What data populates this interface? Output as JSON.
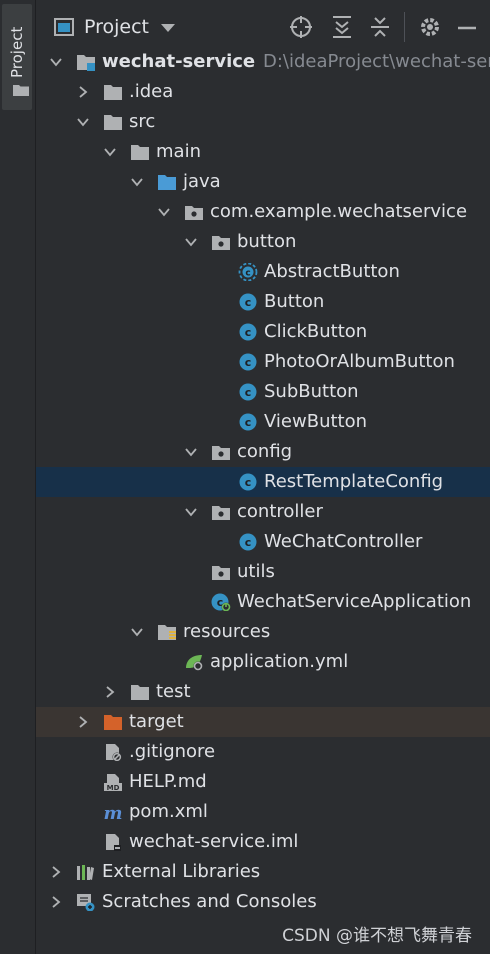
{
  "sidebar": {
    "tab_label": "Project"
  },
  "header": {
    "title": "Project"
  },
  "tree": [
    {
      "label": "wechat-service",
      "path": "D:\\ideaProject\\wechat-servic",
      "depth": 0,
      "arrow": "down",
      "icon": "module-folder-icon",
      "bold": true
    },
    {
      "label": ".idea",
      "depth": 1,
      "arrow": "right",
      "icon": "folder-icon"
    },
    {
      "label": "src",
      "depth": 1,
      "arrow": "down",
      "icon": "folder-icon"
    },
    {
      "label": "main",
      "depth": 2,
      "arrow": "down",
      "icon": "folder-icon"
    },
    {
      "label": "java",
      "depth": 3,
      "arrow": "down",
      "icon": "source-folder-icon"
    },
    {
      "label": "com.example.wechatservice",
      "depth": 4,
      "arrow": "down",
      "icon": "package-icon"
    },
    {
      "label": "button",
      "depth": 5,
      "arrow": "down",
      "icon": "package-icon"
    },
    {
      "label": "AbstractButton",
      "depth": 6,
      "arrow": "none",
      "icon": "abstract-class-icon"
    },
    {
      "label": "Button",
      "depth": 6,
      "arrow": "none",
      "icon": "class-icon"
    },
    {
      "label": "ClickButton",
      "depth": 6,
      "arrow": "none",
      "icon": "class-icon"
    },
    {
      "label": "PhotoOrAlbumButton",
      "depth": 6,
      "arrow": "none",
      "icon": "class-icon"
    },
    {
      "label": "SubButton",
      "depth": 6,
      "arrow": "none",
      "icon": "class-icon"
    },
    {
      "label": "ViewButton",
      "depth": 6,
      "arrow": "none",
      "icon": "class-icon"
    },
    {
      "label": "config",
      "depth": 5,
      "arrow": "down",
      "icon": "package-icon"
    },
    {
      "label": "RestTemplateConfig",
      "depth": 6,
      "arrow": "none",
      "icon": "class-icon",
      "selected": true
    },
    {
      "label": "controller",
      "depth": 5,
      "arrow": "down",
      "icon": "package-icon"
    },
    {
      "label": "WeChatController",
      "depth": 6,
      "arrow": "none",
      "icon": "class-icon"
    },
    {
      "label": "utils",
      "depth": 5,
      "arrow": "none",
      "icon": "package-icon"
    },
    {
      "label": "WechatServiceApplication",
      "depth": 5,
      "arrow": "none",
      "icon": "spring-boot-class-icon"
    },
    {
      "label": "resources",
      "depth": 3,
      "arrow": "down",
      "icon": "resources-folder-icon"
    },
    {
      "label": "application.yml",
      "depth": 4,
      "arrow": "none",
      "icon": "spring-yml-icon"
    },
    {
      "label": "test",
      "depth": 2,
      "arrow": "right",
      "icon": "folder-icon"
    },
    {
      "label": "target",
      "depth": 1,
      "arrow": "right",
      "icon": "excluded-folder-icon",
      "excluded": true
    },
    {
      "label": ".gitignore",
      "depth": 1,
      "arrow": "none",
      "icon": "gitignore-file-icon"
    },
    {
      "label": "HELP.md",
      "depth": 1,
      "arrow": "none",
      "icon": "markdown-file-icon"
    },
    {
      "label": "pom.xml",
      "depth": 1,
      "arrow": "none",
      "icon": "maven-file-icon"
    },
    {
      "label": "wechat-service.iml",
      "depth": 1,
      "arrow": "none",
      "icon": "iml-file-icon"
    },
    {
      "label": "External Libraries",
      "depth": 0,
      "arrow": "right",
      "icon": "libraries-icon"
    },
    {
      "label": "Scratches and Consoles",
      "depth": 0,
      "arrow": "right",
      "icon": "scratches-icon"
    }
  ],
  "watermark": "CSDN @谁不想飞舞青春",
  "colors": {
    "background": "#2b2d30",
    "selection": "#173049",
    "excluded": "#3a3532",
    "class_icon": "#3592c4",
    "source_folder": "#4a9bd6",
    "excluded_folder": "#d4622a"
  }
}
